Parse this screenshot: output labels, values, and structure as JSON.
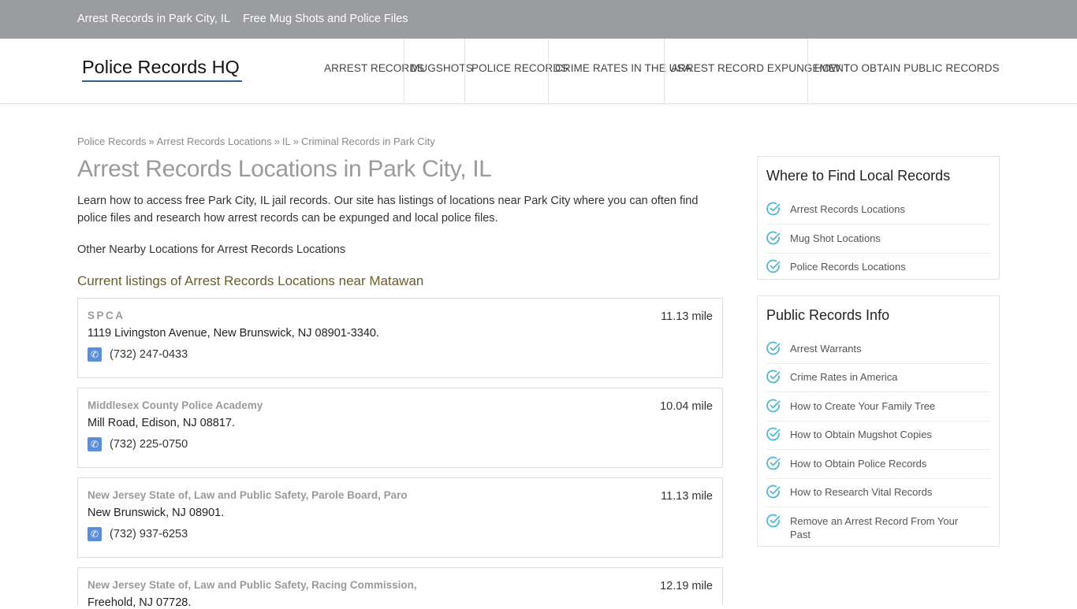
{
  "topbar": {
    "links": [
      "Arrest Records in Park City, IL",
      "Free Mug Shots and Police Files"
    ]
  },
  "header": {
    "logo": "Police Records HQ",
    "nav": [
      "ARREST RECORDS",
      "MUGSHOTS",
      "POLICE RECORDS",
      "CRIME RATES IN THE USA",
      "ARREST RECORD EXPUNGEMENT",
      "HOW TO OBTAIN PUBLIC RECORDS"
    ]
  },
  "breadcrumb": [
    "Police Records",
    "Arrest Records Locations",
    "IL",
    "Criminal Records in Park City"
  ],
  "breadcrumb_separator": "»",
  "main": {
    "title": "Arrest Records Locations in Park City, IL",
    "intro": "Learn how to access free Park City, IL jail records. Our site has listings of locations near Park City where you can often find police files and research how arrest records can be expunged and local police files.",
    "nearby": "Other Nearby Locations for Arrest Records Locations",
    "listings_heading": "Current listings of Arrest Records Locations near Matawan",
    "listings": [
      {
        "name": "SPCA",
        "distance": "11.13 mile",
        "address": "1119 Livingston Avenue, New Brunswick, NJ 08901-3340.",
        "phone": "(732) 247-0433"
      },
      {
        "name": "Middlesex County Police Academy",
        "distance": "10.04 mile",
        "address": "Mill Road, Edison, NJ 08817.",
        "phone": "(732) 225-0750"
      },
      {
        "name": "New Jersey State of, Law and Public Safety, Parole Board, Paro",
        "distance": "11.13 mile",
        "address": "New Brunswick, NJ 08901.",
        "phone": "(732) 937-6253"
      },
      {
        "name": "New Jersey State of, Law and Public Safety, Racing Commission,",
        "distance": "12.19 mile",
        "address": "Freehold, NJ 07728.",
        "phone": ""
      }
    ]
  },
  "sidebar": {
    "local": {
      "title": "Where to Find Local Records",
      "items": [
        "Arrest Records Locations",
        "Mug Shot Locations",
        "Police Records Locations"
      ]
    },
    "info": {
      "title": "Public Records Info",
      "items": [
        "Arrest Warrants",
        "Crime Rates in America",
        "How to Create Your Family Tree",
        "How to Obtain Mugshot Copies",
        "How to Obtain Police Records",
        "How to Research Vital Records",
        "Remove an Arrest Record From Your Past"
      ]
    }
  },
  "colors": {
    "topbar": "#9a9c9f",
    "logo_underline": "#2f5f99",
    "heading_accent": "#6a5d2a",
    "check_icon": "#4fb8d4",
    "phone_icon": "#5b8ed6"
  },
  "icons": {
    "phone": "phone-icon",
    "check": "check-circle-icon"
  }
}
